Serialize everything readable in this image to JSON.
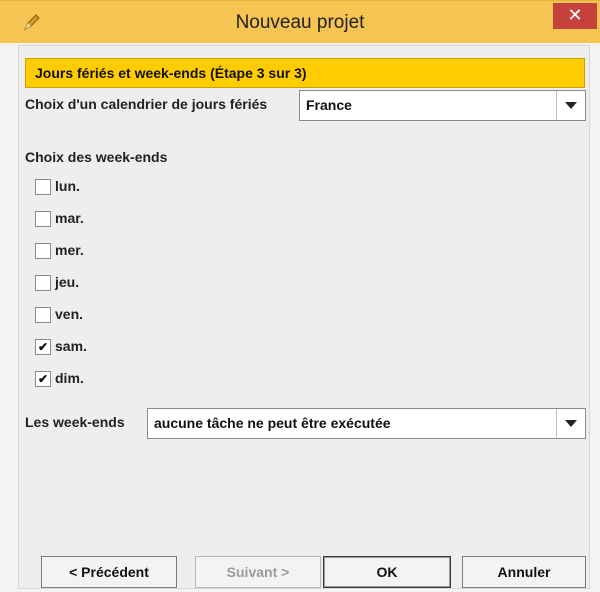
{
  "window": {
    "title": "Nouveau projet",
    "close_glyph": "✕",
    "icon": "app-pencil-icon"
  },
  "banner": {
    "text": "Jours fériés et week-ends (Étape 3 sur 3)"
  },
  "holidays": {
    "label": "Choix d'un calendrier de jours fériés",
    "value": "France"
  },
  "weekends": {
    "label": "Choix des week-ends",
    "days": [
      {
        "label": "lun.",
        "checked": false
      },
      {
        "label": "mar.",
        "checked": false
      },
      {
        "label": "mer.",
        "checked": false
      },
      {
        "label": "jeu.",
        "checked": false
      },
      {
        "label": "ven.",
        "checked": false
      },
      {
        "label": "sam.",
        "checked": true
      },
      {
        "label": "dim.",
        "checked": true
      }
    ],
    "check_glyph": "✔"
  },
  "weekend_rule": {
    "label": "Les week-ends",
    "value": "aucune tâche ne peut être exécutée"
  },
  "buttons": {
    "previous": "< Précédent",
    "next": "Suivant >",
    "ok": "OK",
    "cancel": "Annuler"
  },
  "colors": {
    "titlebar": "#f6c453",
    "banner": "#ffcc00",
    "close": "#c7413c"
  }
}
